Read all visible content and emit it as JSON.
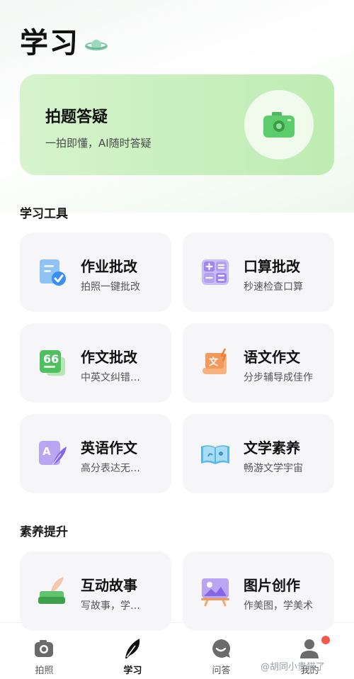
{
  "page": {
    "title": "学习"
  },
  "hero": {
    "title": "拍题答疑",
    "subtitle": "一拍即懂，AI随时答疑"
  },
  "tools_section": {
    "title": "学习工具",
    "cards": [
      {
        "title": "作业批改",
        "subtitle": "拍照一键批改",
        "icon": "homework-check-icon"
      },
      {
        "title": "口算批改",
        "subtitle": "秒速检查口算",
        "icon": "calculator-icon"
      },
      {
        "title": "作文批改",
        "subtitle": "中英文纠错…",
        "icon": "essay-quote-icon"
      },
      {
        "title": "语文作文",
        "subtitle": "分步辅导成佳作",
        "icon": "scroll-icon"
      },
      {
        "title": "英语作文",
        "subtitle": "高分表达无…",
        "icon": "english-quill-icon"
      },
      {
        "title": "文学素养",
        "subtitle": "畅游文学宇宙",
        "icon": "open-book-icon"
      }
    ]
  },
  "literacy_section": {
    "title": "素养提升",
    "cards": [
      {
        "title": "互动故事",
        "subtitle": "写故事，学…",
        "icon": "inkwell-feather-icon"
      },
      {
        "title": "图片创作",
        "subtitle": "作美图，学美术",
        "icon": "easel-picture-icon"
      }
    ]
  },
  "bottom_nav": {
    "items": [
      {
        "label": "拍照",
        "icon": "camera-icon"
      },
      {
        "label": "学习",
        "icon": "feather-icon",
        "active": true
      },
      {
        "label": "问答",
        "icon": "chat-bubble-icon"
      },
      {
        "label": "我的",
        "icon": "profile-icon",
        "badge": true
      }
    ]
  },
  "watermark": "@胡同小贵猫了",
  "colors": {
    "accent_green": "#5ccd6a",
    "hero_bg": "#cdf0c2",
    "card_bg": "#f6f6f8",
    "badge_red": "#f45a4a"
  }
}
